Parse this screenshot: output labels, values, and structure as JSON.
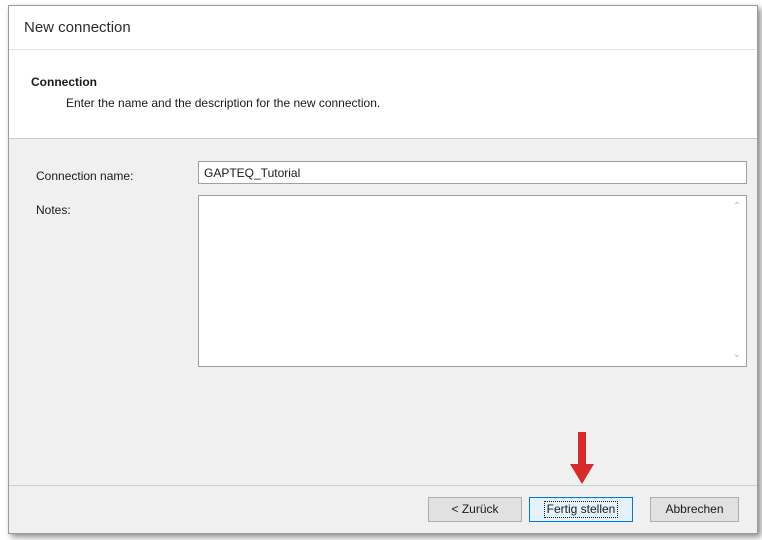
{
  "window": {
    "title": "New connection"
  },
  "header": {
    "heading": "Connection",
    "description": "Enter the name and the description for the new connection."
  },
  "form": {
    "connection_name_label": "Connection name:",
    "connection_name_value": "GAPTEQ_Tutorial",
    "notes_label": "Notes:",
    "notes_value": ""
  },
  "footer": {
    "back_label": "< Zurück",
    "finish_label": "Fertig stellen",
    "cancel_label": "Abbrechen"
  },
  "icons": {
    "scroll_up": "scroll-up-icon",
    "scroll_down": "scroll-down-icon",
    "annotation": "red-arrow-down-icon"
  },
  "colors": {
    "annotation_arrow": "#d62b2b",
    "focus_border": "#0078d7"
  }
}
